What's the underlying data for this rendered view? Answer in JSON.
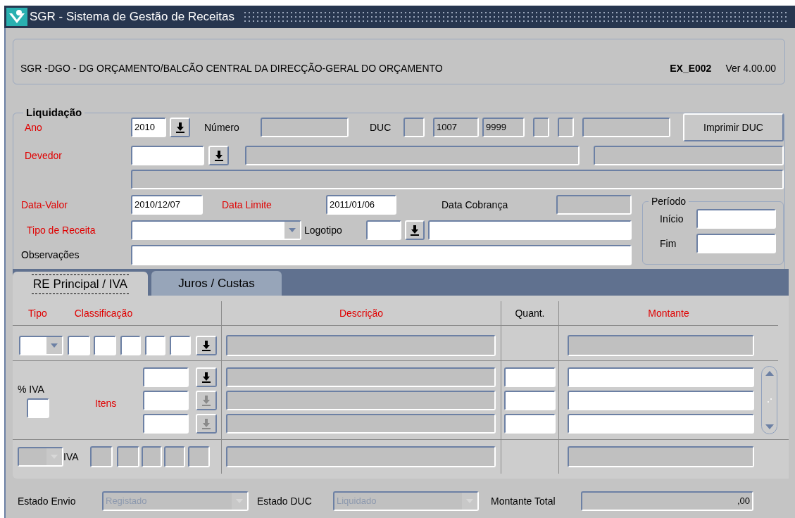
{
  "window": {
    "title": "SGR - Sistema de Gestão de Receitas"
  },
  "header": {
    "organization": "SGR -DGO - DG ORÇAMENTO/BALCÃO CENTRAL DA DIRECÇÃO-GERAL DO ORÇAMENTO",
    "form_code": "EX_E002",
    "version": "Ver 4.00.00"
  },
  "liquidacao": {
    "title": "Liquidação",
    "ano": {
      "label": "Ano",
      "required": true,
      "value": "2010"
    },
    "numero": {
      "label": "Número",
      "required": false
    },
    "duc": {
      "label": "DUC",
      "required": false,
      "codes": [
        "1007",
        "9999"
      ]
    },
    "print_button": "Imprimir DUC",
    "devedor": {
      "label": "Devedor",
      "required": true
    },
    "data_valor": {
      "label": "Data-Valor",
      "required": true,
      "value": "2010/12/07"
    },
    "data_limite": {
      "label": "Data Limite",
      "required": true,
      "value": "2011/01/06"
    },
    "data_cobranca": {
      "label": "Data Cobrança",
      "required": false
    },
    "tipo_receita": {
      "label": "Tipo de Receita",
      "required": true
    },
    "logotipo": {
      "label": "Logotipo",
      "required": false
    },
    "observacoes": {
      "label": "Observações",
      "required": false
    },
    "periodo": {
      "title": "Período",
      "inicio": "Início",
      "fim": "Fim"
    }
  },
  "tabs": [
    {
      "label": "RE Principal / IVA",
      "selected": true
    },
    {
      "label": "Juros / Custas",
      "selected": false
    }
  ],
  "grid": {
    "columns": [
      {
        "label": "Tipo",
        "required": true
      },
      {
        "label": "Classificação",
        "required": true
      },
      {
        "label": "Descrição",
        "required": true
      },
      {
        "label": "Quant.",
        "required": false
      },
      {
        "label": "Montante",
        "required": true
      }
    ],
    "iva": {
      "label": "% IVA",
      "required": false
    },
    "itens": {
      "label": "Itens",
      "required": true
    },
    "items": [
      {
        "lov_enabled": true
      },
      {
        "lov_enabled": false
      },
      {
        "lov_enabled": false
      }
    ],
    "iva_row": {
      "label": "IVA",
      "disabled": true
    }
  },
  "status": {
    "estado_envio": {
      "label": "Estado Envio",
      "required": false,
      "value": "Registado",
      "disabled": true
    },
    "estado_duc": {
      "label": "Estado DUC",
      "required": false,
      "value": "Liquidado",
      "disabled": true
    },
    "montante_total": {
      "label": "Montante Total",
      "required": false,
      "value": ",00"
    }
  }
}
